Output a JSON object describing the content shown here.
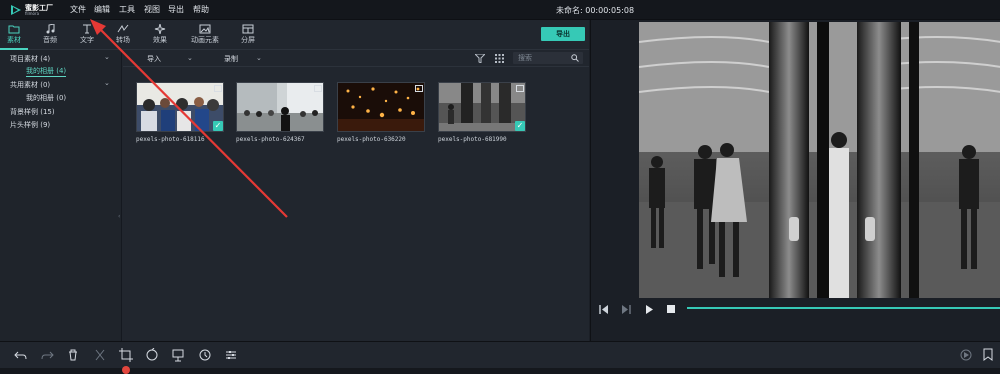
{
  "app": {
    "logo_text": "蜜影工厂",
    "logo_sub": "filmora",
    "menu": [
      "文件",
      "编辑",
      "工具",
      "视图",
      "导出",
      "帮助"
    ],
    "project_title": "未命名: 00:00:05:08"
  },
  "tabs": [
    {
      "label": "素材",
      "icon": "folder-icon"
    },
    {
      "label": "音频",
      "icon": "music-note-icon"
    },
    {
      "label": "文字",
      "icon": "text-icon"
    },
    {
      "label": "转场",
      "icon": "transition-icon"
    },
    {
      "label": "效果",
      "icon": "effects-icon"
    },
    {
      "label": "动画元素",
      "icon": "image-icon"
    },
    {
      "label": "分屏",
      "icon": "split-screen-icon"
    }
  ],
  "export_label": "导出",
  "tree": {
    "project_media": "项目素材 (4)",
    "my_album": "我的相册 (4)",
    "shared_media": "共用素材 (0)",
    "shared_album": "我的相册 (0)",
    "background_samples": "背景样例 (15)",
    "intro_samples": "片头样例 (9)"
  },
  "toolbar": {
    "import_label": "导入",
    "record_label": "录制",
    "search_placeholder": "搜索"
  },
  "media": [
    {
      "caption": "pexels-photo-618116",
      "checked": true
    },
    {
      "caption": "pexels-photo-624367",
      "checked": false
    },
    {
      "caption": "pexels-photo-636220",
      "checked": false
    },
    {
      "caption": "pexels-photo-681990",
      "checked": true
    }
  ],
  "colors": {
    "accent": "#36c9b6",
    "background": "#1b1f26",
    "panel": "#21262e",
    "playhead": "#e2463d",
    "annotation_arrow": "#e53935"
  }
}
